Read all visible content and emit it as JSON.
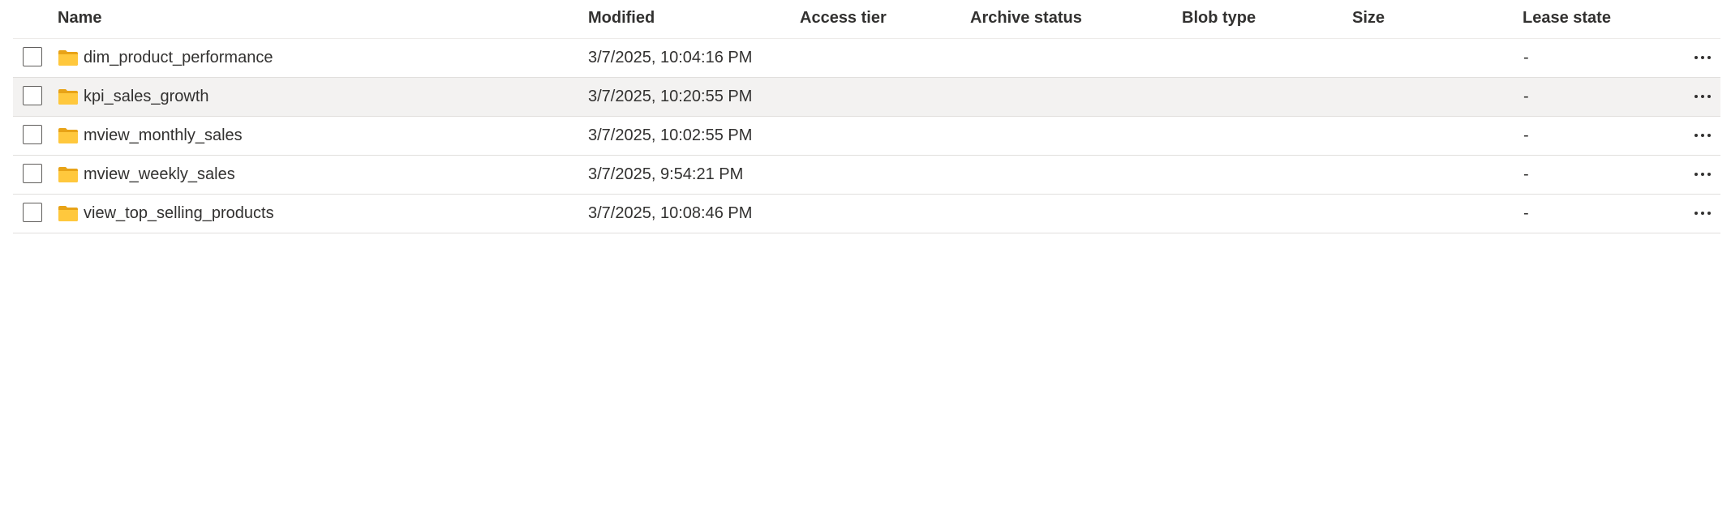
{
  "columns": {
    "name": "Name",
    "modified": "Modified",
    "access_tier": "Access tier",
    "archive_status": "Archive status",
    "blob_type": "Blob type",
    "size": "Size",
    "lease_state": "Lease state"
  },
  "colors": {
    "folder": "#ffc83d",
    "folder_tab": "#e8a317",
    "selected_row": "#f3f2f1"
  },
  "rows": [
    {
      "name": "dim_product_performance",
      "modified": "3/7/2025, 10:04:16 PM",
      "lease_state": "-",
      "icon": "folder-icon",
      "selected": false
    },
    {
      "name": "kpi_sales_growth",
      "modified": "3/7/2025, 10:20:55 PM",
      "lease_state": "-",
      "icon": "folder-icon",
      "selected": true
    },
    {
      "name": "mview_monthly_sales",
      "modified": "3/7/2025, 10:02:55 PM",
      "lease_state": "-",
      "icon": "folder-icon",
      "selected": false
    },
    {
      "name": "mview_weekly_sales",
      "modified": "3/7/2025, 9:54:21 PM",
      "lease_state": "-",
      "icon": "folder-icon",
      "selected": false
    },
    {
      "name": "view_top_selling_products",
      "modified": "3/7/2025, 10:08:46 PM",
      "lease_state": "-",
      "icon": "folder-icon",
      "selected": false
    }
  ]
}
